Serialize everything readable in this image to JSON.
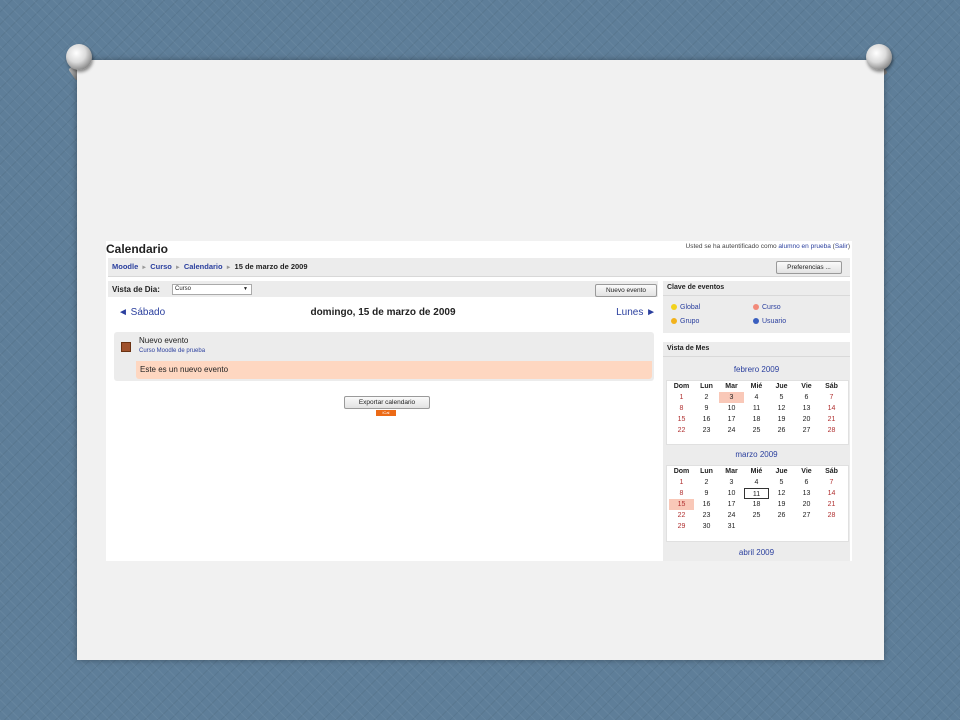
{
  "page": {
    "title": "Calendario",
    "login": {
      "prefix": "Usted se ha autentificado como ",
      "user": "alumno en prueba",
      "paren_open": " (",
      "logout": "Salir",
      "paren_close": ")"
    }
  },
  "breadcrumb": {
    "items": [
      "Moodle",
      "Curso",
      "Calendario"
    ],
    "current": "15 de marzo de 2009",
    "separator": "►"
  },
  "toolbar": {
    "preferences_label": "Preferencias ..."
  },
  "day_view": {
    "label": "Vista de Dia:",
    "select_value": "Curso",
    "new_event_label": "Nuevo evento",
    "prev_label": "◄ Sábado",
    "date_title": "domingo, 15 de marzo de 2009",
    "next_label": "Lunes ►"
  },
  "event": {
    "name": "Nuevo evento",
    "course": "Curso Moodle de prueba",
    "description": "Este es un nuevo evento"
  },
  "export": {
    "button_label": "Exportar calendario",
    "ical_label": "iCal"
  },
  "legend": {
    "title": "Clave de eventos",
    "items": [
      {
        "label": "Global",
        "color": "#f2d21c"
      },
      {
        "label": "Curso",
        "color": "#f28a7a"
      },
      {
        "label": "Grupo",
        "color": "#f2b21c"
      },
      {
        "label": "Usuario",
        "color": "#3a5fbf"
      }
    ]
  },
  "month_view": {
    "title": "Vista de Mes",
    "weekdays": [
      "Dom",
      "Lun",
      "Mar",
      "Mié",
      "Jue",
      "Vie",
      "Sáb"
    ],
    "months": [
      {
        "name": "febrero 2009",
        "weeks": [
          [
            "1",
            "2",
            "3",
            "4",
            "5",
            "6",
            "7"
          ],
          [
            "8",
            "9",
            "10",
            "11",
            "12",
            "13",
            "14"
          ],
          [
            "15",
            "16",
            "17",
            "18",
            "19",
            "20",
            "21"
          ],
          [
            "22",
            "23",
            "24",
            "25",
            "26",
            "27",
            "28"
          ]
        ],
        "highlight": [
          "3"
        ],
        "today": []
      },
      {
        "name": "marzo 2009",
        "weeks": [
          [
            "1",
            "2",
            "3",
            "4",
            "5",
            "6",
            "7"
          ],
          [
            "8",
            "9",
            "10",
            "11",
            "12",
            "13",
            "14"
          ],
          [
            "15",
            "16",
            "17",
            "18",
            "19",
            "20",
            "21"
          ],
          [
            "22",
            "23",
            "24",
            "25",
            "26",
            "27",
            "28"
          ],
          [
            "29",
            "30",
            "31",
            "",
            "",
            "",
            ""
          ]
        ],
        "highlight": [
          "15"
        ],
        "today": [
          "11"
        ]
      },
      {
        "name": "abril 2009",
        "weeks": [],
        "highlight": [],
        "today": []
      }
    ]
  },
  "colors": {
    "link": "#2a3f9e",
    "weekend": "#b03030",
    "event_highlight": "#fed7c1",
    "ical": "#ec6a16"
  }
}
